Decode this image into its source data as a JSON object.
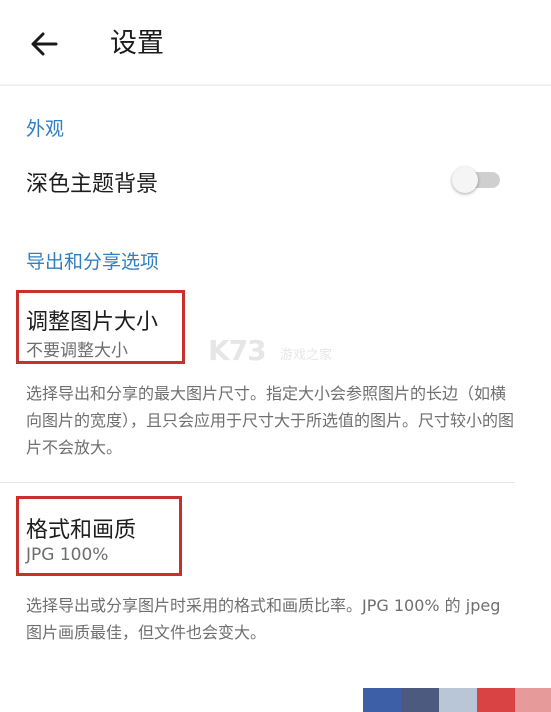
{
  "header": {
    "title": "设置",
    "back_icon": "arrow-left-icon"
  },
  "sections": {
    "appearance": {
      "header": "外观",
      "dark_theme_label": "深色主题背景",
      "dark_theme_enabled": false
    },
    "export_share": {
      "header": "导出和分享选项",
      "resize": {
        "title": "调整图片大小",
        "value": "不要调整大小",
        "description": "选择导出和分享的最大图片尺寸。指定大小会参照图片的长边（如横向图片的宽度），且只会应用于尺寸大于所选值的图片。尺寸较小的图片不会放大。"
      },
      "format": {
        "title": "格式和画质",
        "value": "JPG 100%",
        "description": "选择导出或分享图片时采用的格式和画质比率。JPG 100% 的 jpeg 图片画质最佳，但文件也会变大。"
      }
    }
  },
  "watermark": {
    "logo": "K73",
    "text": "游戏之家"
  },
  "colors": {
    "accent": "#2f7fc4",
    "highlight_box": "#c8302c",
    "swatches": [
      "#3d5fa8",
      "#4b5a7e",
      "#b9c6d8",
      "#d94343",
      "#e69a9a"
    ]
  }
}
